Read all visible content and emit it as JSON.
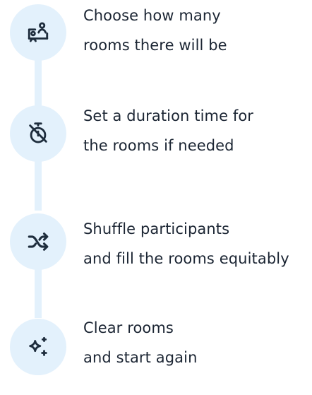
{
  "steps": [
    {
      "icon": "rooms-icon",
      "lines": [
        "Choose how many",
        "rooms there will be"
      ]
    },
    {
      "icon": "timer-off-icon",
      "lines": [
        "Set a duration time for",
        "the rooms if needed"
      ]
    },
    {
      "icon": "shuffle-icon",
      "lines": [
        "Shuffle participants",
        "and fill the rooms equitably"
      ]
    },
    {
      "icon": "sparkles-icon",
      "lines": [
        "Clear rooms",
        "and start again"
      ]
    }
  ],
  "colors": {
    "circle_bg": "#e3f1fc",
    "icon": "#1e2d3d",
    "text": "#1b2533"
  }
}
